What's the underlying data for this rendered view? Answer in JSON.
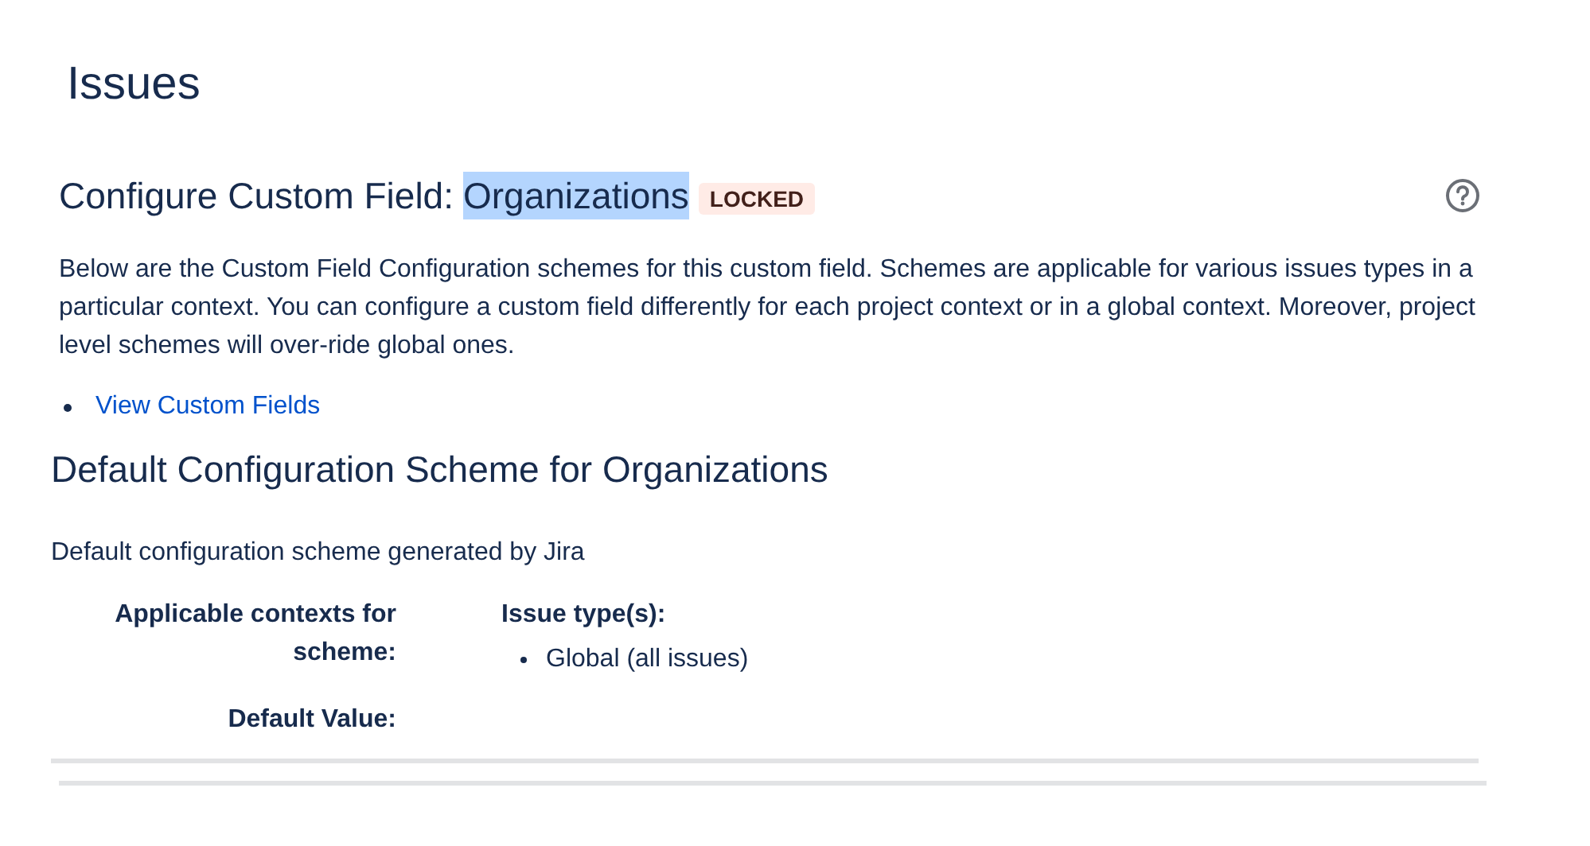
{
  "page_title": "Issues",
  "header": {
    "prefix": "Configure Custom Field:",
    "field_name": "Organizations",
    "highlighted": true,
    "badge": "LOCKED"
  },
  "description": "Below are the Custom Field Configuration schemes for this custom field. Schemes are applicable for various issues types in a particular context. You can configure a custom field differently for each project context or in a global context. Moreover, project level schemes will over-ride global ones.",
  "links": [
    "View Custom Fields"
  ],
  "scheme": {
    "title": "Default Configuration Scheme for Organizations",
    "description": "Default configuration scheme generated by Jira",
    "rows": [
      {
        "label": "Applicable contexts for scheme:",
        "heading": "Issue type(s):",
        "items": [
          "Global (all issues)"
        ]
      },
      {
        "label": "Default Value:"
      }
    ]
  }
}
